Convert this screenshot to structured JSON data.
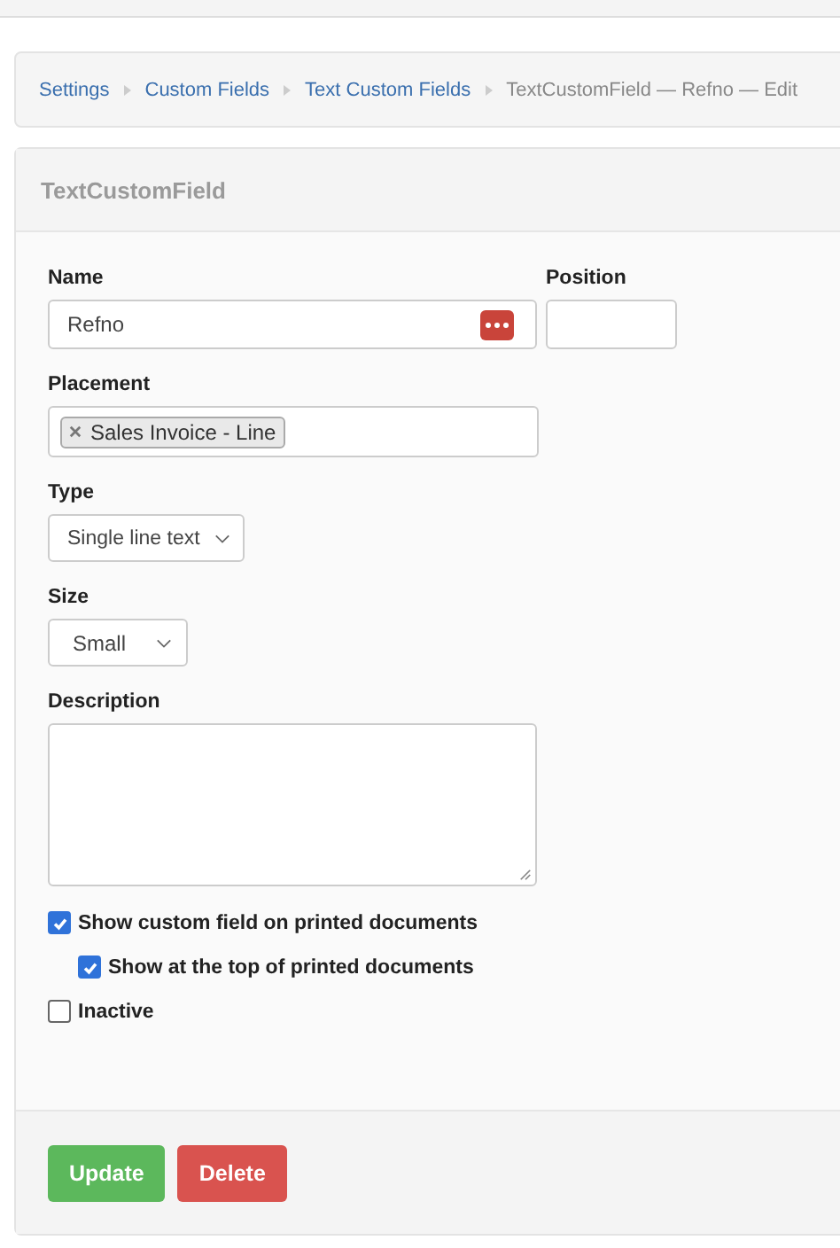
{
  "breadcrumb": [
    {
      "label": "Settings",
      "kind": "link"
    },
    {
      "label": "Custom Fields",
      "kind": "link"
    },
    {
      "label": "Text Custom Fields",
      "kind": "link"
    },
    {
      "label": "TextCustomField — Refno — Edit",
      "kind": "current"
    }
  ],
  "panel": {
    "title": "TextCustomField"
  },
  "form": {
    "name": {
      "label": "Name",
      "value": "Refno"
    },
    "position": {
      "label": "Position"
    },
    "placement": {
      "label": "Placement",
      "tags": [
        "Sales Invoice - Line"
      ]
    },
    "type": {
      "label": "Type",
      "value": "Single line text"
    },
    "size": {
      "label": "Size",
      "value": "Small"
    },
    "description": {
      "label": "Description"
    },
    "checkboxes": [
      {
        "label": "Show custom field on printed documents",
        "checked": true,
        "children": [
          {
            "label": "Show at the top of printed documents",
            "checked": true
          }
        ]
      },
      {
        "label": "Inactive",
        "checked": false
      }
    ]
  },
  "buttons": [
    {
      "label": "Update",
      "kind": "success"
    },
    {
      "label": "Delete",
      "kind": "danger"
    }
  ]
}
